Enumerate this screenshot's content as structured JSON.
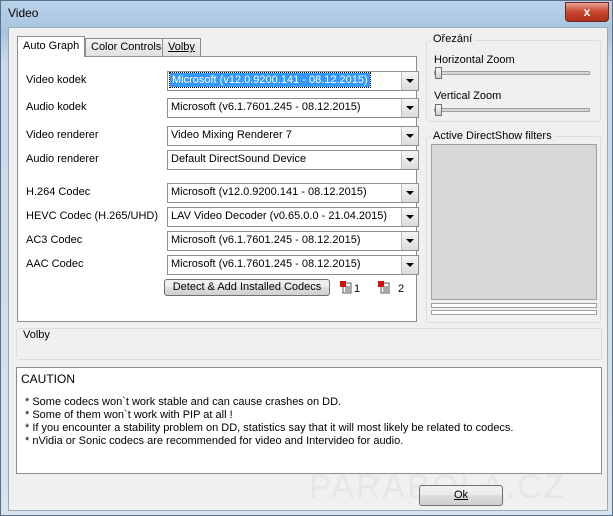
{
  "window": {
    "title": "Video",
    "close_label": "x"
  },
  "tabs": [
    {
      "label": "Auto Graph"
    },
    {
      "label": "Color Controls"
    },
    {
      "label": "Volby"
    }
  ],
  "auto_graph": {
    "rows": [
      {
        "label": "Video kodek",
        "value": "Microsoft   (v12.0.9200.141 - 08.12.2015)"
      },
      {
        "label": "Audio kodek",
        "value": "Microsoft   (v6.1.7601.245 - 08.12.2015)"
      },
      {
        "label": "Video renderer",
        "value": "Video Mixing Renderer 7"
      },
      {
        "label": "Audio renderer",
        "value": "Default DirectSound Device"
      },
      {
        "label": "H.264 Codec",
        "value": "Microsoft   (v12.0.9200.141 - 08.12.2015)"
      },
      {
        "label": "HEVC Codec (H.265/UHD)",
        "value": "LAV Video Decoder   (v0.65.0.0 - 21.04.2015)"
      },
      {
        "label": "AC3 Codec",
        "value": "Microsoft   (v6.1.7601.245 - 08.12.2015)"
      },
      {
        "label": "AAC Codec",
        "value": "Microsoft   (v6.1.7601.245 - 08.12.2015)"
      }
    ],
    "detect_button": "Detect & Add Installed Codecs",
    "codec_link_1": "1",
    "codec_link_2": "2"
  },
  "cropping": {
    "title": "Ořezání",
    "horizontal_zoom": "Horizontal Zoom",
    "vertical_zoom": "Vertical Zoom",
    "horizontal_zoom_level": 0,
    "vertical_zoom_level": 0
  },
  "filters": {
    "title": "Active DirectShow filters"
  },
  "options": {
    "title": "Volby"
  },
  "caution": {
    "title": "CAUTION",
    "lines": [
      "*  Some codecs won`t work stable and can cause crashes on DD.",
      "*  Some of them won`t work with PIP at all !",
      "*  If you encounter a stability problem on DD, statistics say that it will most likely be related to codecs.",
      "*  nVidia or Sonic codecs are recommended for video and Intervideo for audio."
    ]
  },
  "ok_button": "Ok",
  "watermark": "PARABOLA.CZ"
}
